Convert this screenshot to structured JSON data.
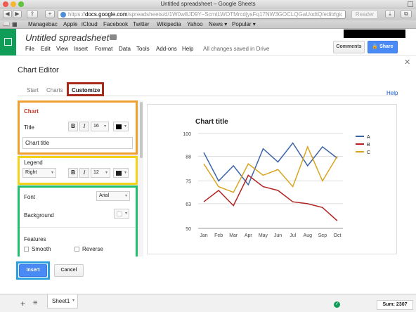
{
  "browser": {
    "window_title": "Untitled spreadsheet – Google Sheets",
    "url_scheme": "https",
    "url_host": "docs.google.com",
    "url_path": "/spreadsheets/d/1W0w8JD9Y–ScmtLWOTMrcdjysFq17NW3GOCLQGaUodtQ/edit#gid=0",
    "reader_label": "Reader",
    "bookmarks": [
      "Managebac",
      "Apple",
      "iCloud",
      "Facebook",
      "Twitter",
      "Wikipedia",
      "Yahoo",
      "News ▾",
      "Popular ▾"
    ]
  },
  "app": {
    "doc_title": "Untitled spreadsheet",
    "menu": [
      "File",
      "Edit",
      "View",
      "Insert",
      "Format",
      "Data",
      "Tools",
      "Add-ons",
      "Help"
    ],
    "save_status": "All changes saved in Drive",
    "comments_label": "Comments",
    "share_label": "Share",
    "colors": {
      "sheets_green": "#0f9d58",
      "blue": "#4a8af4"
    }
  },
  "dialog": {
    "title": "Chart Editor",
    "tabs": [
      "Start",
      "Charts",
      "Customize"
    ],
    "active_tab": "Customize",
    "help_label": "Help",
    "chart_section": {
      "title": "Chart",
      "title_label": "Title",
      "bold": "B",
      "italic": "I",
      "font_size": "16",
      "title_value": "Chart title"
    },
    "legend_section": {
      "label": "Legend",
      "position": "Right",
      "bold": "B",
      "italic": "I",
      "font_size": "12"
    },
    "font_section": {
      "font_label": "Font",
      "font_value": "Arial",
      "background_label": "Background"
    },
    "features": {
      "label": "Features",
      "smooth": "Smooth",
      "reverse": "Reverse"
    },
    "insert_label": "Insert",
    "cancel_label": "Cancel",
    "highlight_colors": {
      "customize": "#a52a1a",
      "chart": "#f0a030",
      "legend": "#f2d21b",
      "font": "#22c06a",
      "insert": "#2aa0e0"
    }
  },
  "chart_data": {
    "type": "line",
    "title": "Chart title",
    "categories": [
      "Jan",
      "Feb",
      "Mar",
      "Apr",
      "May",
      "Jun",
      "Jul",
      "Aug",
      "Sep",
      "Oct"
    ],
    "y_ticks": [
      100,
      88,
      75,
      63,
      50
    ],
    "ylim": [
      50,
      100
    ],
    "series": [
      {
        "name": "A",
        "color": "#3c64a8",
        "values": [
          90,
          75,
          83,
          73,
          92,
          85,
          95,
          83,
          93,
          87
        ]
      },
      {
        "name": "B",
        "color": "#b22222",
        "values": [
          64,
          70,
          62,
          78,
          72,
          70,
          64,
          63,
          61,
          54
        ]
      },
      {
        "name": "C",
        "color": "#d9a520",
        "values": [
          84,
          72,
          69,
          84,
          78,
          81,
          72,
          93,
          75,
          88
        ]
      }
    ],
    "legend_position": "right",
    "grid": true
  },
  "bottom_bar": {
    "sheet_name": "Sheet1",
    "sum_label": "Sum: 2307"
  }
}
